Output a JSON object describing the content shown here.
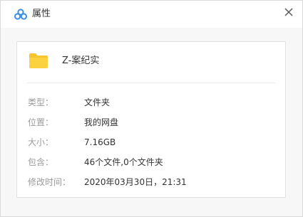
{
  "window": {
    "title": "属性"
  },
  "panel": {
    "folder_name": "Z-案纪实",
    "properties": [
      {
        "label": "类型：",
        "value": "文件夹"
      },
      {
        "label": "位置：",
        "value": "我的网盘"
      },
      {
        "label": "大小：",
        "value": "7.16GB"
      },
      {
        "label": "包含：",
        "value": "46个文件,0个文件夹"
      },
      {
        "label": "修改时间：",
        "value": "2020年03月30日，21:31"
      }
    ]
  },
  "colors": {
    "folder": "#f7c531",
    "app_icon": "#3a8ee6",
    "label_text": "#9a9a9a",
    "value_text": "#333333"
  },
  "icons": {
    "app": "baidu-netdisk-icon",
    "close": "close-icon",
    "folder": "folder-icon"
  }
}
